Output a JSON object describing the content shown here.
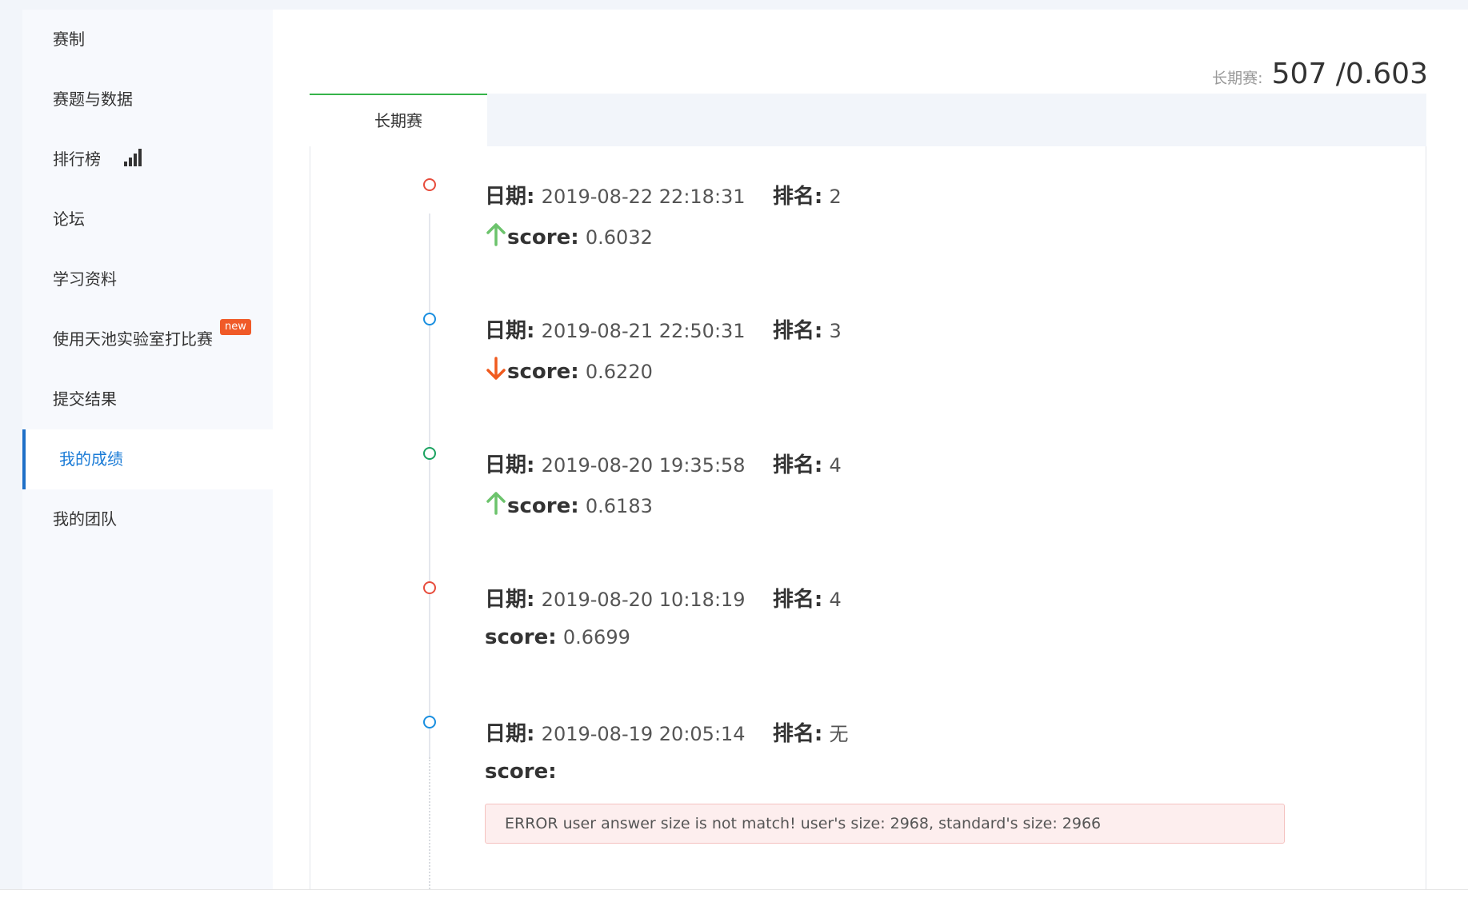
{
  "sidebar": {
    "items": [
      {
        "label": "赛制"
      },
      {
        "label": "赛题与数据"
      },
      {
        "label": "排行榜"
      },
      {
        "label": "论坛"
      },
      {
        "label": "学习资料"
      },
      {
        "label": "使用天池实验室打比赛",
        "badge": "new"
      },
      {
        "label": "提交结果"
      },
      {
        "label": "我的成绩",
        "active": true
      },
      {
        "label": "我的团队"
      }
    ]
  },
  "summary": {
    "label": "长期赛:",
    "value": "507 /0.603"
  },
  "tabs": [
    {
      "label": "长期赛",
      "active": true
    }
  ],
  "entry_labels": {
    "date": "日期:",
    "rank": "排名:",
    "score": "score:"
  },
  "entries": [
    {
      "date": "2019-08-22 22:18:31",
      "rank": "2",
      "score": "0.6032",
      "trend": "up",
      "dot_color": "#e74c3c"
    },
    {
      "date": "2019-08-21 22:50:31",
      "rank": "3",
      "score": "0.6220",
      "trend": "down",
      "dot_color": "#1a8fe0"
    },
    {
      "date": "2019-08-20 19:35:58",
      "rank": "4",
      "score": "0.6183",
      "trend": "up",
      "dot_color": "#1aa260"
    },
    {
      "date": "2019-08-20 10:18:19",
      "rank": "4",
      "score": "0.6699",
      "trend": "none",
      "dot_color": "#e74c3c"
    },
    {
      "date": "2019-08-19 20:05:14",
      "rank": "无",
      "score": "",
      "trend": "none",
      "dot_color": "#1a8fe0",
      "error": "ERROR user answer size is not match! user's size: 2968, standard's size: 2966"
    }
  ],
  "colors": {
    "up_arrow": "#6cc36c",
    "down_arrow": "#f05a1e",
    "active_nav": "#1a7bd6",
    "tab_accent": "#36b34a"
  },
  "icons": {
    "leaderboard": "bar-chart-icon",
    "up": "arrow-up-icon",
    "down": "arrow-down-icon"
  }
}
